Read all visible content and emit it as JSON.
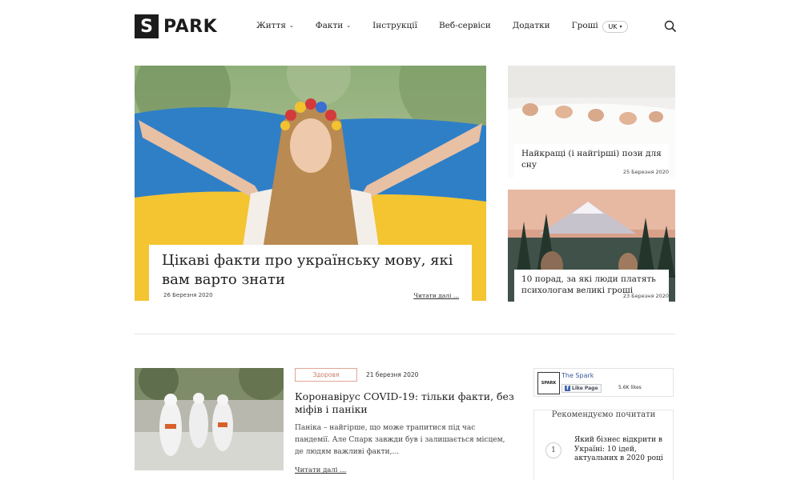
{
  "brand": {
    "logo_letter": "S",
    "logo_text": "PARK"
  },
  "nav": {
    "items": [
      {
        "label": "Життя",
        "dropdown": true
      },
      {
        "label": "Факти",
        "dropdown": true
      },
      {
        "label": "Інструкції",
        "dropdown": false
      },
      {
        "label": "Веб-сервіси",
        "dropdown": false
      },
      {
        "label": "Додатки",
        "dropdown": false
      },
      {
        "label": "Гроші",
        "dropdown": false
      }
    ],
    "language": "UK",
    "search_icon": "search-icon"
  },
  "hero": {
    "title": "Цікаві факти про українську мову, які вам варто знати",
    "date": "26 Березня 2020",
    "more": "Читати далі ..."
  },
  "side_posts": [
    {
      "title": "Найкращі (і найгірші) пози для сну",
      "date": "25 Березня 2020"
    },
    {
      "title": "10 порад, за які люди платять психологам великі гроші",
      "date": "23 Березня 2020"
    }
  ],
  "article": {
    "tag": "Здоровя",
    "date": "21 березня 2020",
    "title": "Коронавірус COVID-19: тільки факти, без міфів і паніки",
    "excerpt": "Паніка – найгірше, що може трапитися під час пандемії. Але Спарк завжди був і залишається місцем, де людям важливі факти,...",
    "more": "Читати далі ..."
  },
  "facebook": {
    "logo": "SPARK",
    "page_name": "The Spark",
    "like_label": "Like Page",
    "likes": "5.6K likes"
  },
  "recommended": {
    "heading": "Рекомендуємо почитати",
    "items": [
      {
        "number": "1",
        "title": "Який бізнес відкрити в Україні: 10 ідей, актуальних в 2020 році"
      }
    ]
  },
  "colors": {
    "accent_tag": "#c97a66",
    "logo_bg": "#1c1c1c",
    "fb_blue": "#3b5998"
  }
}
